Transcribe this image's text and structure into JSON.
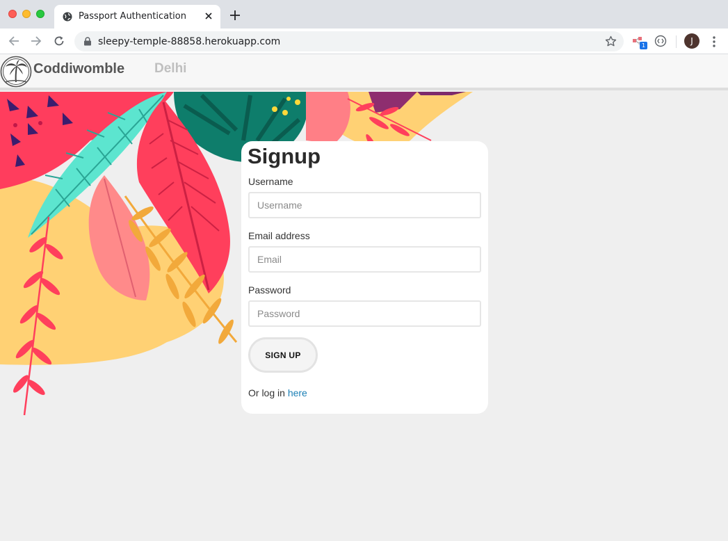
{
  "browser": {
    "tab_title": "Passport Authentication",
    "url": "sleepy-temple-88858.herokuapp.com",
    "extension_badge": "1",
    "profile_initial": "J"
  },
  "navbar": {
    "brand": "Coddiwomble",
    "city": "Delhi"
  },
  "form": {
    "title": "Signup",
    "username_label": "Username",
    "username_placeholder": "Username",
    "email_label": "Email address",
    "email_placeholder": "Email",
    "password_label": "Password",
    "password_placeholder": "Password",
    "submit_label": "SIGN UP",
    "login_prefix": "Or log in",
    "login_link": "here"
  },
  "colors": {
    "link": "#1a7fb5",
    "brand_text": "#555555",
    "city_text": "#bfbfbf"
  }
}
